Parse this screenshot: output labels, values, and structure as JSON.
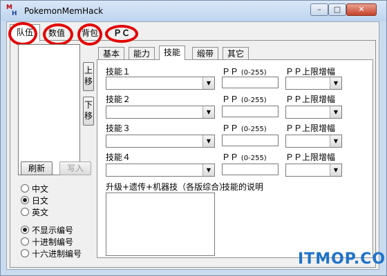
{
  "window": {
    "title": "PokemonMemHack",
    "icon_m": "M",
    "icon_h": "H",
    "min_symbol": "–",
    "max_symbol": "□",
    "close_symbol": "✕"
  },
  "outer_tabs": [
    {
      "label": "队伍"
    },
    {
      "label": "数值"
    },
    {
      "label": "背包"
    },
    {
      "label": "ＰＣ"
    }
  ],
  "highlight_color": "#e30000",
  "side": {
    "up_button": "上移",
    "down_button": "下移",
    "refresh_button": "刷新",
    "write_button": "写入"
  },
  "language": {
    "options": [
      "中文",
      "日文",
      "英文"
    ],
    "selected": "日文"
  },
  "numbering": {
    "options": [
      "不显示编号",
      "十进制编号",
      "十六进制编号"
    ],
    "selected": "不显示编号"
  },
  "inner_tabs": [
    {
      "label": "基本"
    },
    {
      "label": "能力"
    },
    {
      "label": "技能",
      "active": true
    },
    {
      "label": "缎带"
    },
    {
      "label": "其它"
    }
  ],
  "skills": [
    {
      "label": "技能１",
      "pp_label": "ＰＰ",
      "pp_range": "(0-255)",
      "pp_max_label": "ＰＰ上限增幅",
      "value": "",
      "pp_value": ""
    },
    {
      "label": "技能２",
      "pp_label": "ＰＰ",
      "pp_range": "(0-255)",
      "pp_max_label": "ＰＰ上限增幅",
      "value": "",
      "pp_value": ""
    },
    {
      "label": "技能３",
      "pp_label": "ＰＰ",
      "pp_range": "(0-255)",
      "pp_max_label": "ＰＰ上限增幅",
      "value": "",
      "pp_value": ""
    },
    {
      "label": "技能４",
      "pp_label": "ＰＰ",
      "pp_range": "(0-255)",
      "pp_max_label": "ＰＰ上限增幅",
      "value": "",
      "pp_value": ""
    }
  ],
  "learnset_label": "升级+遗传+机器技（各版综合）",
  "description_label": "技能的说明",
  "dropdown_arrow": "▼",
  "watermark": "ITMOP.COM"
}
